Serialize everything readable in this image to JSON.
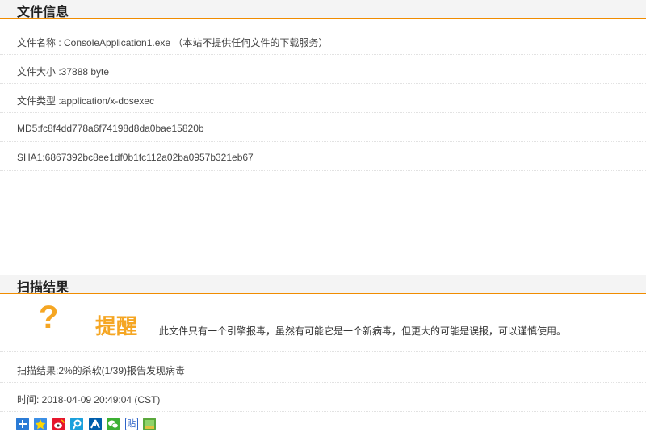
{
  "file_info": {
    "header": "文件信息",
    "rows": [
      "文件名称 : ConsoleApplication1.exe  （本站不提供任何文件的下载服务）",
      "文件大小 :37888 byte",
      "文件类型 :application/x-dosexec",
      "MD5:fc8f4dd778a6f74198d8da0bae15820b",
      "SHA1:6867392bc8ee1df0b1fc112a02ba0957b321eb67"
    ]
  },
  "scan_result": {
    "header": "扫描结果",
    "alert_symbol": "?",
    "alert_title": "提醒",
    "alert_message": "此文件只有一个引擎报毒，虽然有可能它是一个新病毒，但更大的可能是误报，可以谨慎使用。",
    "summary": "扫描结果:2%的杀软(1/39)报告发现病毒",
    "time": "时间: 2018-04-09 20:49:04 (CST)"
  },
  "share": {
    "icons": [
      {
        "name": "share-more-icon",
        "color": "#2b7bd6"
      },
      {
        "name": "qzone-icon",
        "color": "#3a8ee6"
      },
      {
        "name": "weibo-icon",
        "color": "#e6162d"
      },
      {
        "name": "tencent-weibo-icon",
        "color": "#1ba0dc"
      },
      {
        "name": "renren-icon",
        "color": "#005eac"
      },
      {
        "name": "wechat-icon",
        "color": "#3cb034"
      },
      {
        "name": "tieba-icon",
        "color": "#2d63c8"
      },
      {
        "name": "mailbox-icon",
        "color": "#5aa83c"
      }
    ],
    "glyph_tieba": "贴"
  },
  "colors": {
    "accent": "#f08c00",
    "alert": "#f5a623"
  }
}
